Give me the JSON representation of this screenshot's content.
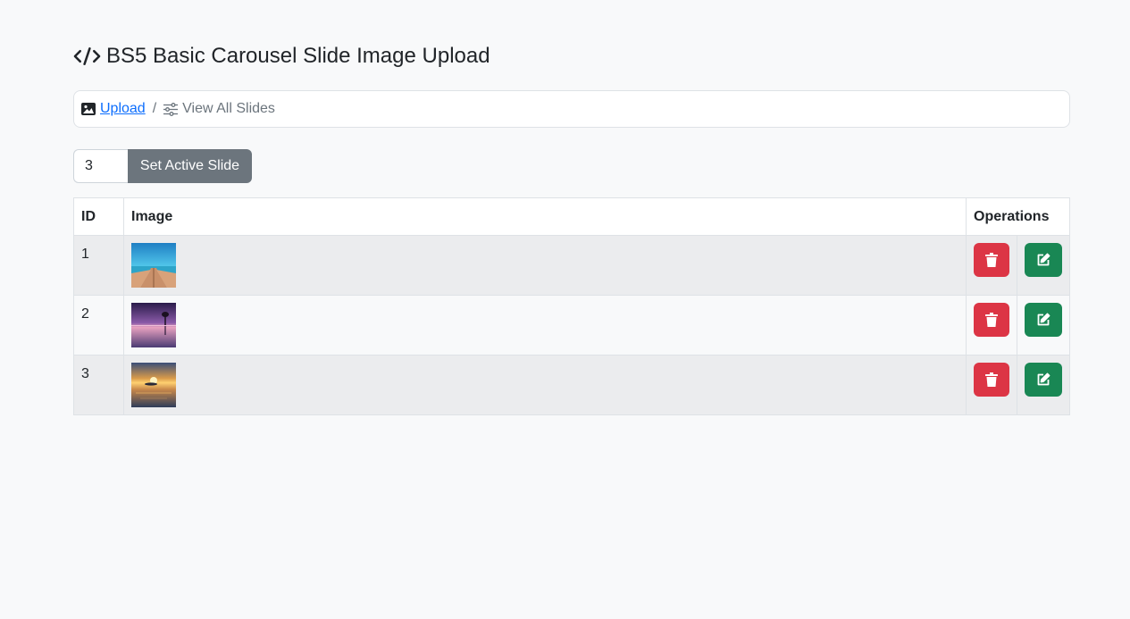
{
  "header": {
    "title": "BS5 Basic Carousel Slide Image Upload",
    "icon": "code-icon"
  },
  "breadcrumb": {
    "items": [
      {
        "label": "Upload",
        "icon": "image-icon",
        "link": true
      },
      {
        "label": "View All Slides",
        "icon": "sliders-icon",
        "link": false
      }
    ],
    "separator": "/"
  },
  "active_slide": {
    "value": "3",
    "button_label": "Set Active Slide"
  },
  "table": {
    "headers": [
      "ID",
      "Image",
      "Operations"
    ],
    "rows": [
      {
        "id": "1",
        "image": "pier-ocean-thumbnail"
      },
      {
        "id": "2",
        "image": "purple-sunset-tree-thumbnail"
      },
      {
        "id": "3",
        "image": "golden-sunset-beach-thumbnail"
      }
    ]
  },
  "colors": {
    "link": "#0d6efd",
    "secondary": "#6c757d",
    "danger": "#dc3545",
    "success": "#198754"
  }
}
